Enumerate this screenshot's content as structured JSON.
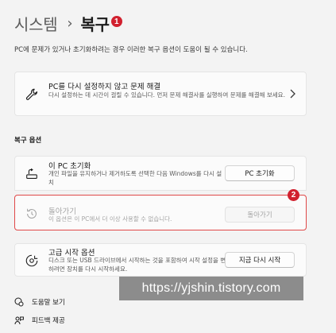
{
  "breadcrumb": {
    "parent": "시스템",
    "separator": "›",
    "current": "복구"
  },
  "markers": {
    "first": "1",
    "second": "2"
  },
  "description": "PC에 문제가 있거나 초기화하려는 경우 이러한 복구 옵션이 도움이 될 수 있습니다.",
  "fix_card": {
    "title": "PC를 다시 설정하지 않고 문제 해결",
    "subtitle": "다시 설정하는 데 시간이 걸릴 수 있습니다. 먼저 문제 해결사를 실행하여 문제를 해결해 보세요.",
    "icon": "wrench-icon"
  },
  "section_label": "복구 옵션",
  "options": {
    "reset": {
      "title": "이 PC 초기화",
      "subtitle": "개인 파일을 유지하거나 제거하도록 선택한 다음 Windows를 다시 설치",
      "button": "PC 초기화",
      "icon": "reset-pc-icon"
    },
    "goback": {
      "title": "돌아가기",
      "subtitle": "이 옵션은 이 PC에서 더 이상 사용할 수 없습니다.",
      "button": "돌아가기",
      "icon": "history-icon",
      "disabled": true
    },
    "advanced": {
      "title": "고급 시작 옵션",
      "subtitle": "디스크 또는 USB 드라이브에서 시작하는 것을 포함하여 시작 설정을 변경하려면 장치를 다시 시작하세요.",
      "button": "지금 다시 시작",
      "icon": "advanced-startup-icon"
    }
  },
  "watermark": "https://yjshin.tistory.com",
  "footer": {
    "help": "도움말 보기",
    "feedback": "피드백 제공"
  },
  "colors": {
    "background": "#f3f3f3",
    "card": "#fbfbfb",
    "marker": "#d1202e",
    "highlight_border": "#e04848"
  }
}
